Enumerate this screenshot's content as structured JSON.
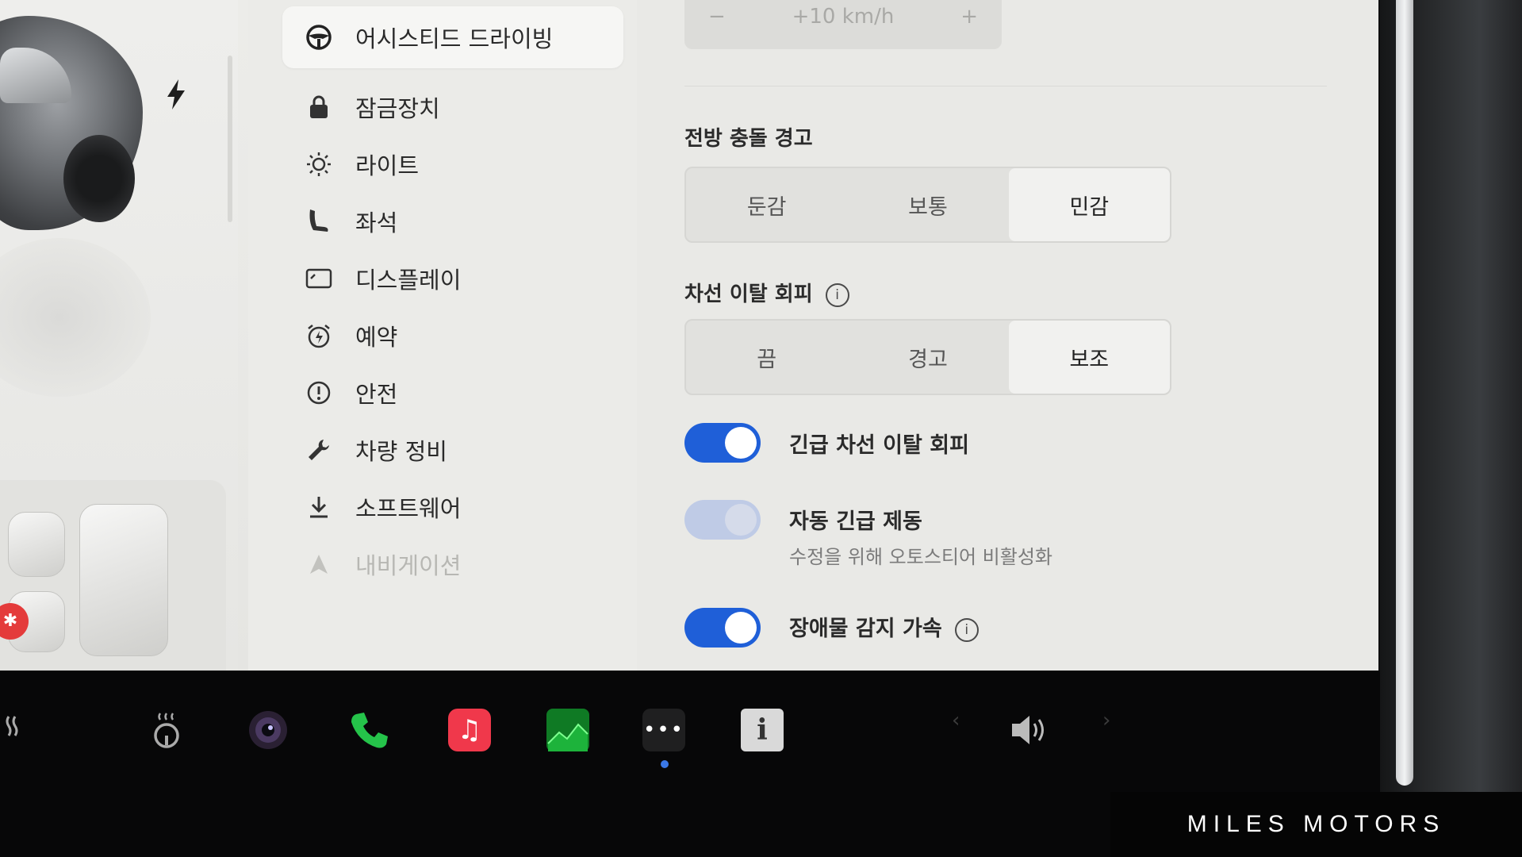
{
  "menu": {
    "items": [
      {
        "label": "어시스티드 드라이빙",
        "icon": "steering-wheel-icon"
      },
      {
        "label": "잠금장치",
        "icon": "lock-icon"
      },
      {
        "label": "라이트",
        "icon": "light-icon"
      },
      {
        "label": "좌석",
        "icon": "seat-icon"
      },
      {
        "label": "디스플레이",
        "icon": "display-icon"
      },
      {
        "label": "예약",
        "icon": "schedule-icon"
      },
      {
        "label": "안전",
        "icon": "safety-icon"
      },
      {
        "label": "차량 정비",
        "icon": "wrench-icon"
      },
      {
        "label": "소프트웨어",
        "icon": "download-icon"
      },
      {
        "label": "내비게이션",
        "icon": "navigation-icon"
      }
    ],
    "active_index": 0
  },
  "speed_offset": {
    "value": "+10 km/h",
    "minus": "−",
    "plus": "+"
  },
  "forward_collision": {
    "title": "전방 충돌 경고",
    "options": [
      "둔감",
      "보통",
      "민감"
    ],
    "selected": "민감"
  },
  "lane_departure": {
    "title": "차선 이탈 회피",
    "info": "i",
    "options": [
      "끔",
      "경고",
      "보조"
    ],
    "selected": "보조"
  },
  "toggles": {
    "emergency_lane": {
      "label": "긴급 차선 이탈 회피",
      "on": true
    },
    "auto_emergency_braking": {
      "label": "자동 긴급 제동",
      "sublabel": "수정을 위해 오토스티어 비활성화",
      "on": true,
      "disabled": true
    },
    "obstacle_accel": {
      "label": "장애물 감지 가속",
      "info": "i",
      "on": true
    }
  },
  "taskbar": {
    "icons": [
      "seat-heater-icon",
      "steering-heater-icon",
      "camera-icon",
      "phone-icon",
      "music-icon",
      "stocks-icon",
      "more-icon",
      "manual-icon",
      "chevron-left-icon",
      "volume-icon",
      "chevron-right-icon"
    ],
    "more_label": "•••",
    "manual_label": "i"
  },
  "brand": "MILES MOTORS",
  "colors": {
    "toggle_on": "#1f5fd8",
    "music": "#f0384b",
    "stocks": "#0f7a24",
    "alert": "#e43b3b"
  }
}
